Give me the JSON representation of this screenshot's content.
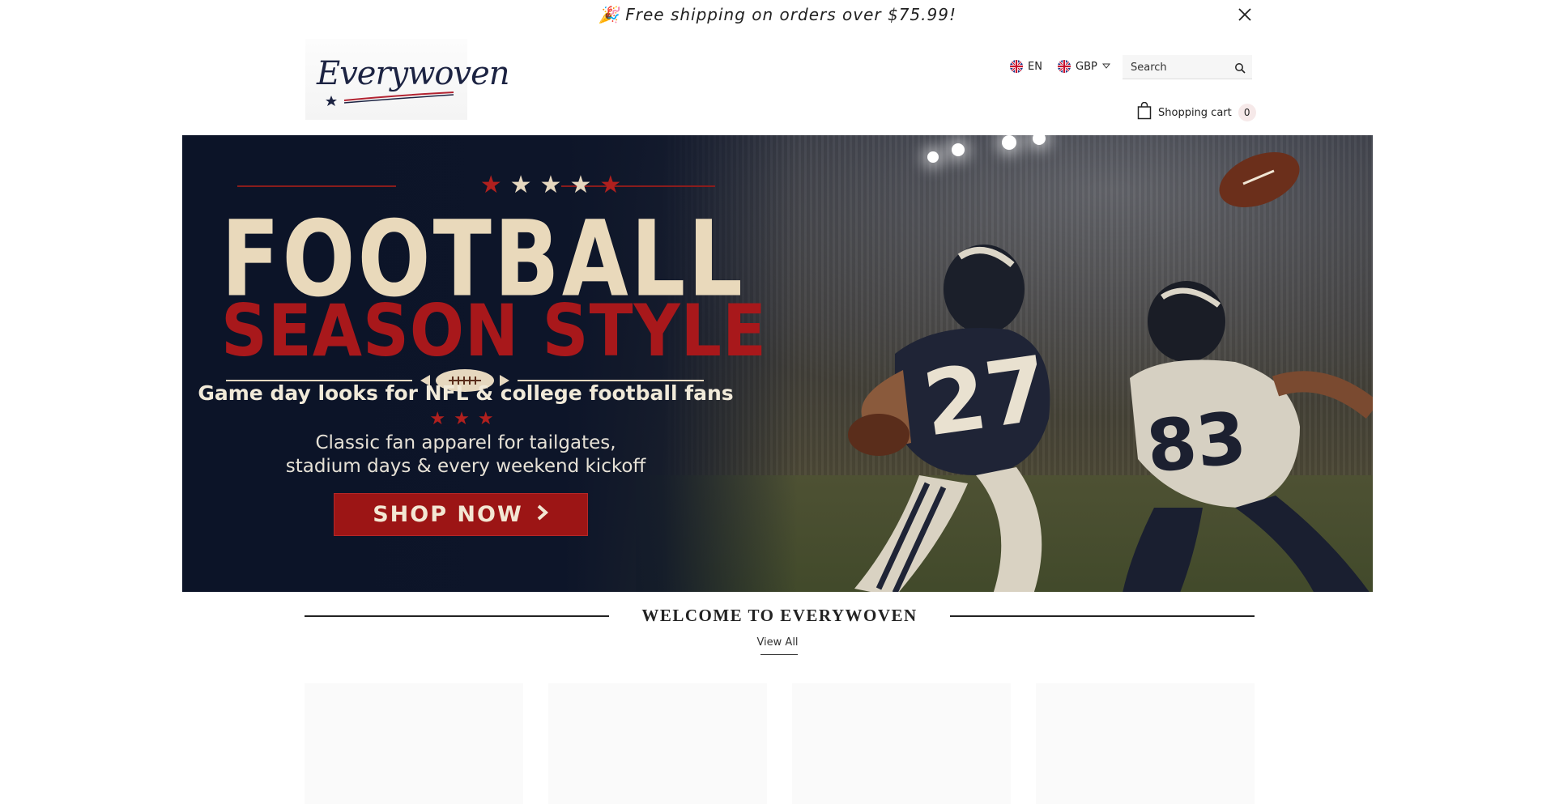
{
  "announcement": {
    "emoji": "🎉",
    "text": "Free shipping on orders over $75.99!"
  },
  "header": {
    "logo_text": "Everywoven",
    "language": "EN",
    "currency": "GBP",
    "search": {
      "placeholder": "Search"
    },
    "cart": {
      "label": "Shopping cart",
      "count": "0"
    }
  },
  "hero": {
    "title": "FOOTBALL",
    "subtitle": "SEASON STYLE",
    "tagline": "Game day looks for NFL & college football fans",
    "description_line1": "Classic fan apparel for tailgates,",
    "description_line2": "stadium days & every weekend kickoff",
    "cta_label": "SHOP NOW",
    "player1_number": "27",
    "player2_number": "83",
    "colors": {
      "navy": "#0d1529",
      "red": "#9c1515",
      "cream": "#e9d9bb"
    }
  },
  "welcome": {
    "title": "WELCOME TO EVERYWOVEN",
    "view_all": "View All"
  },
  "products": {
    "placeholders": 4
  }
}
